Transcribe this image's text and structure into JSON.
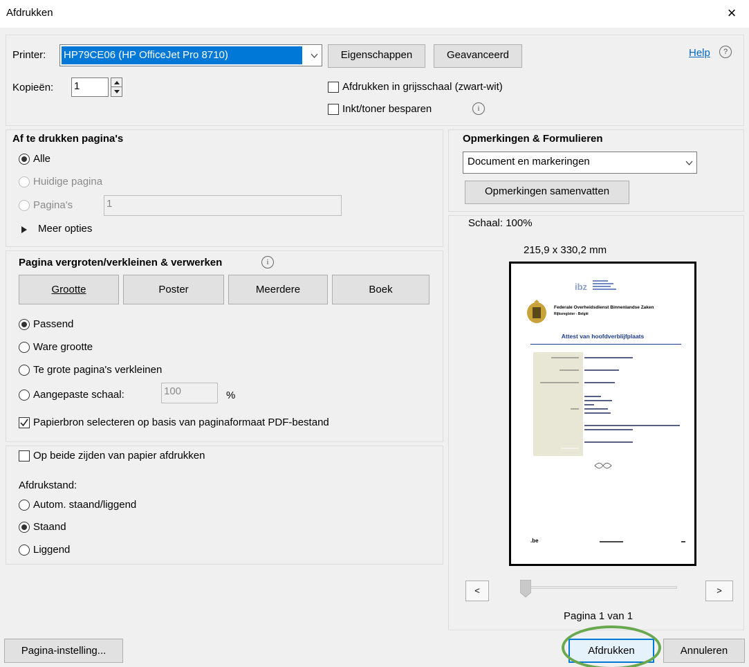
{
  "window": {
    "title": "Afdrukken",
    "close_glyph": "×"
  },
  "printer": {
    "label": "Printer:",
    "selected": "HP79CE06 (HP OfficeJet Pro 8710)",
    "properties_button": "Eigenschappen",
    "advanced_button": "Geavanceerd",
    "help_link": "Help",
    "help_icon": "?"
  },
  "copies": {
    "label": "Kopieën:",
    "value": "1"
  },
  "options": {
    "grayscale": {
      "label": "Afdrukken in grijsschaal (zwart-wit)",
      "checked": false
    },
    "save_ink": {
      "label": "Inkt/toner besparen",
      "checked": false
    },
    "info_glyph": "i"
  },
  "pages": {
    "heading": "Af te drukken pagina's",
    "all": "Alle",
    "current": "Huidige pagina",
    "range": "Pagina's",
    "range_value": "1",
    "more_options": "Meer opties",
    "selected": "all"
  },
  "sizing": {
    "heading": "Pagina vergroten/verkleinen & verwerken",
    "tabs": [
      "Grootte",
      "Poster",
      "Meerdere",
      "Boek"
    ],
    "fit": "Passend",
    "actual": "Ware grootte",
    "shrink": "Te grote pagina's verkleinen",
    "custom": "Aangepaste schaal:",
    "custom_value": "100",
    "percent": "%",
    "paper_source": "Papierbron selecteren op basis van paginaformaat PDF-bestand",
    "selected": "fit"
  },
  "duplex": {
    "label": "Op beide zijden van papier afdrukken",
    "orientation_label": "Afdrukstand:",
    "auto": "Autom. staand/liggend",
    "portrait": "Staand",
    "landscape": "Liggend",
    "selected": "portrait"
  },
  "comments": {
    "heading": "Opmerkingen & Formulieren",
    "selected": "Document en markeringen",
    "summarize_button": "Opmerkingen samenvatten"
  },
  "preview": {
    "scale": "Schaal: 100%",
    "dimensions": "215,9 x 330,2 mm",
    "prev": "<",
    "next": ">",
    "page_indicator": "Pagina 1 van 1",
    "doc": {
      "logo": "ibz",
      "org_line1": "Federale Overheidsdienst Binnenlandse Zaken",
      "org_line2": "Rijksregister - België",
      "doc_title": "Attest van hoofdverblijfplaats",
      "footer_logo": ".be"
    }
  },
  "footer": {
    "page_setup": "Pagina-instelling...",
    "print": "Afdrukken",
    "cancel": "Annuleren"
  },
  "colors": {
    "highlight": "#0078d7",
    "link": "#0066cc",
    "annotation_circle": "#6aa84f"
  }
}
